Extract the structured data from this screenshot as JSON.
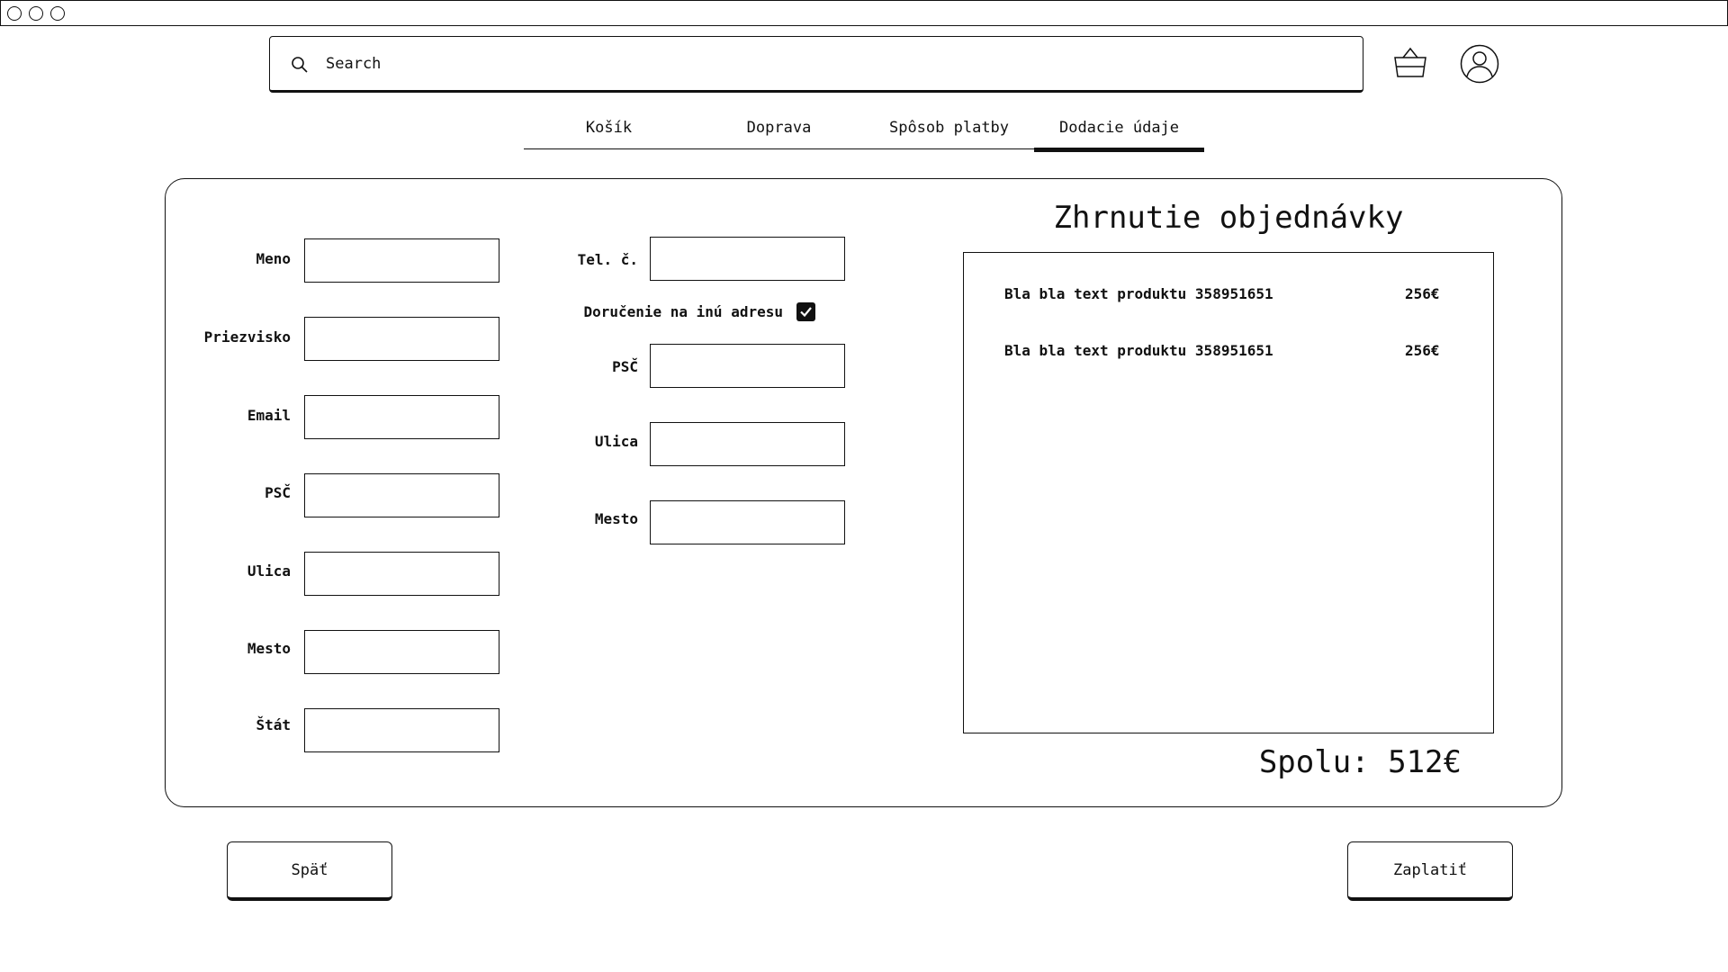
{
  "window": {
    "controls": [
      "close",
      "minimize",
      "maximize"
    ]
  },
  "search": {
    "placeholder": "Search",
    "icon": "search-icon"
  },
  "header_icons": [
    "basket-icon",
    "user-account-icon"
  ],
  "tabs": [
    {
      "label": "Košík",
      "active": false
    },
    {
      "label": "Doprava",
      "active": false
    },
    {
      "label": "Spôsob platby",
      "active": false
    },
    {
      "label": "Dodacie údaje",
      "active": true
    }
  ],
  "form_left": [
    {
      "label": "Meno",
      "value": ""
    },
    {
      "label": "Priezvisko",
      "value": ""
    },
    {
      "label": "Email",
      "value": ""
    },
    {
      "label": "PSČ",
      "value": ""
    },
    {
      "label": "Ulica",
      "value": ""
    },
    {
      "label": "Mesto",
      "value": ""
    },
    {
      "label": "Štát",
      "value": ""
    }
  ],
  "form_right": {
    "phone": {
      "label": "Tel. č.",
      "value": ""
    },
    "delivery_other_address": {
      "label": "Doručenie na inú adresu",
      "checked": true
    },
    "fields": [
      {
        "label": "PSČ",
        "value": ""
      },
      {
        "label": "Ulica",
        "value": ""
      },
      {
        "label": "Mesto",
        "value": ""
      }
    ]
  },
  "summary": {
    "title": "Zhrnutie objednávky",
    "items": [
      {
        "name": "Bla bla text produktu 358951651",
        "price": "256€"
      },
      {
        "name": "Bla bla text produktu 358951651",
        "price": "256€"
      }
    ],
    "total": "Spolu: 512€"
  },
  "buttons": {
    "back": "Späť",
    "pay": "Zaplatiť"
  },
  "colors": {
    "stroke": "#111111",
    "background": "#ffffff"
  }
}
